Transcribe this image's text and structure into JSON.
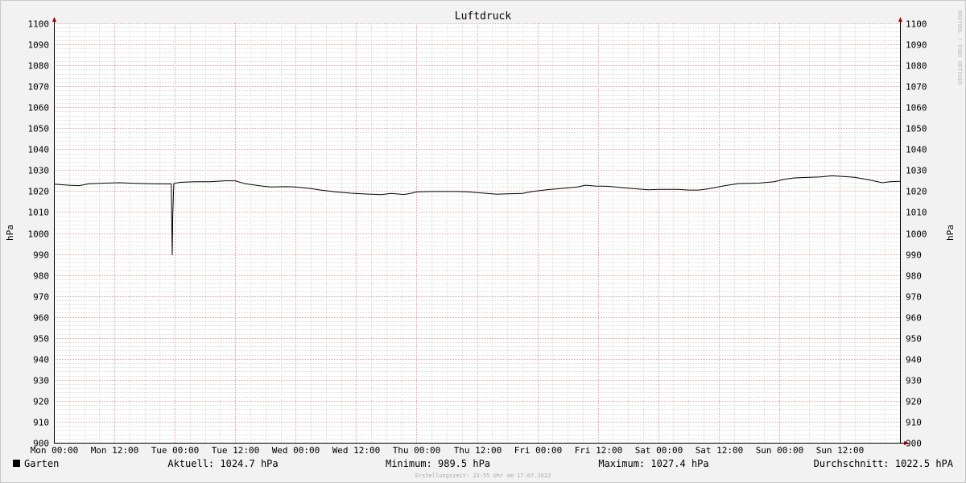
{
  "watermark": "RRDTOOL / TOBI OETIKER",
  "footer": {
    "created": "Erstellungszeit: 23:55 Uhr am 17.07.2022"
  },
  "legend": {
    "series_name": "Garten",
    "current": "Aktuell: 1024.7 hPa",
    "minimum": "Minimum: 989.5 hPa",
    "maximum": "Maximum: 1027.4 hPa",
    "average": "Durchschnitt: 1022.5 hPA"
  },
  "chart_data": {
    "type": "line",
    "title": "Luftdruck",
    "ylabel_left": "hPa",
    "ylabel_right": "hPa",
    "xlim_hours": [
      0,
      168
    ],
    "ylim": [
      900,
      1100
    ],
    "y_ticks": [
      900,
      910,
      920,
      930,
      940,
      950,
      960,
      970,
      980,
      990,
      1000,
      1010,
      1020,
      1030,
      1040,
      1050,
      1060,
      1070,
      1080,
      1090,
      1100
    ],
    "x_ticks": [
      {
        "h": 0,
        "label": "Mon 00:00"
      },
      {
        "h": 12,
        "label": "Mon 12:00"
      },
      {
        "h": 24,
        "label": "Tue 00:00"
      },
      {
        "h": 36,
        "label": "Tue 12:00"
      },
      {
        "h": 48,
        "label": "Wed 00:00"
      },
      {
        "h": 60,
        "label": "Wed 12:00"
      },
      {
        "h": 72,
        "label": "Thu 00:00"
      },
      {
        "h": 84,
        "label": "Thu 12:00"
      },
      {
        "h": 96,
        "label": "Fri 00:00"
      },
      {
        "h": 108,
        "label": "Fri 12:00"
      },
      {
        "h": 120,
        "label": "Sat 00:00"
      },
      {
        "h": 132,
        "label": "Sat 12:00"
      },
      {
        "h": 144,
        "label": "Sun 00:00"
      },
      {
        "h": 156,
        "label": "Sun 12:00"
      }
    ],
    "grid": true,
    "legend_position": "bottom",
    "series": [
      {
        "name": "Garten",
        "color": "#000000",
        "points": [
          [
            0,
            1023.3
          ],
          [
            3,
            1022.8
          ],
          [
            5,
            1022.6
          ],
          [
            7,
            1023.5
          ],
          [
            10,
            1023.8
          ],
          [
            13,
            1024.0
          ],
          [
            16,
            1023.7
          ],
          [
            19,
            1023.5
          ],
          [
            22.5,
            1023.4
          ],
          [
            23.3,
            1023.4
          ],
          [
            23.4,
            1004.0
          ],
          [
            23.5,
            989.5
          ],
          [
            23.6,
            1008.0
          ],
          [
            23.8,
            1023.6
          ],
          [
            25,
            1024.2
          ],
          [
            28,
            1024.5
          ],
          [
            31,
            1024.5
          ],
          [
            34,
            1024.9
          ],
          [
            36,
            1024.9
          ],
          [
            38,
            1023.5
          ],
          [
            41,
            1022.5
          ],
          [
            43,
            1022.0
          ],
          [
            46,
            1022.1
          ],
          [
            48,
            1022.0
          ],
          [
            51,
            1021.2
          ],
          [
            53,
            1020.5
          ],
          [
            56,
            1019.6
          ],
          [
            59,
            1019.0
          ],
          [
            62,
            1018.6
          ],
          [
            65,
            1018.3
          ],
          [
            67,
            1018.9
          ],
          [
            69.5,
            1018.4
          ],
          [
            71,
            1019.0
          ],
          [
            72,
            1019.6
          ],
          [
            75,
            1019.8
          ],
          [
            80,
            1019.8
          ],
          [
            82,
            1019.7
          ],
          [
            84,
            1019.3
          ],
          [
            86,
            1018.9
          ],
          [
            88,
            1018.5
          ],
          [
            90,
            1018.7
          ],
          [
            93,
            1018.9
          ],
          [
            95,
            1019.8
          ],
          [
            98,
            1020.7
          ],
          [
            101,
            1021.3
          ],
          [
            104,
            1022.0
          ],
          [
            105.5,
            1022.8
          ],
          [
            107.5,
            1022.4
          ],
          [
            110,
            1022.3
          ],
          [
            113,
            1021.6
          ],
          [
            116,
            1021.0
          ],
          [
            118,
            1020.6
          ],
          [
            120,
            1020.8
          ],
          [
            124,
            1020.8
          ],
          [
            126,
            1020.5
          ],
          [
            128,
            1020.5
          ],
          [
            130,
            1021.1
          ],
          [
            133,
            1022.5
          ],
          [
            136,
            1023.6
          ],
          [
            140,
            1023.8
          ],
          [
            143,
            1024.5
          ],
          [
            145,
            1025.6
          ],
          [
            147,
            1026.3
          ],
          [
            150,
            1026.6
          ],
          [
            152,
            1026.7
          ],
          [
            154.5,
            1027.3
          ],
          [
            157,
            1026.9
          ],
          [
            159,
            1026.6
          ],
          [
            162,
            1025.3
          ],
          [
            164.5,
            1024.0
          ],
          [
            166,
            1024.5
          ],
          [
            168,
            1024.7
          ]
        ]
      }
    ]
  }
}
